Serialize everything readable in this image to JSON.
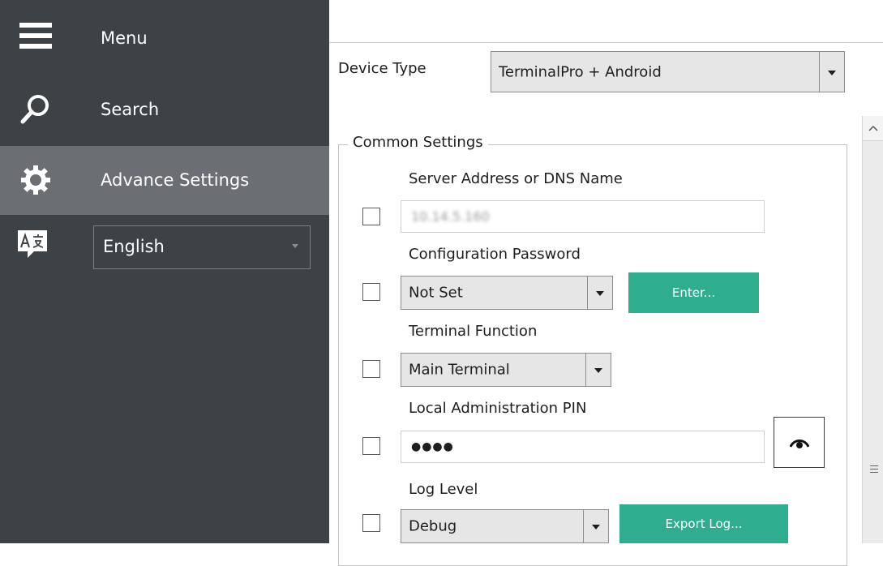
{
  "sidebar": {
    "menu_label": "Menu",
    "search_label": "Search",
    "advance_label": "Advance Settings",
    "language": {
      "selected": "English"
    },
    "colors": {
      "background": "#3d4247",
      "selected": "#6b6f74"
    }
  },
  "main": {
    "device_type_label": "Device Type",
    "device_type_value": "TerminalPro + Android",
    "group_title": "Common Settings",
    "server_address": {
      "label": "Server Address or DNS Name",
      "value": "10.14.5.160"
    },
    "config_password": {
      "label": "Configuration Password",
      "value": "Not Set",
      "button": "Enter..."
    },
    "terminal_function": {
      "label": "Terminal Function",
      "value": "Main Terminal"
    },
    "local_admin_pin": {
      "label": "Local Administration PIN",
      "value": "●●●●"
    },
    "log_level": {
      "label": "Log Level",
      "value": "Debug",
      "button": "Export Log..."
    }
  },
  "colors": {
    "accent": "#2fad8f"
  },
  "icons": [
    "hamburger-icon",
    "search-icon",
    "gear-icon",
    "language-icon",
    "eye-icon",
    "chevron-up-icon"
  ]
}
